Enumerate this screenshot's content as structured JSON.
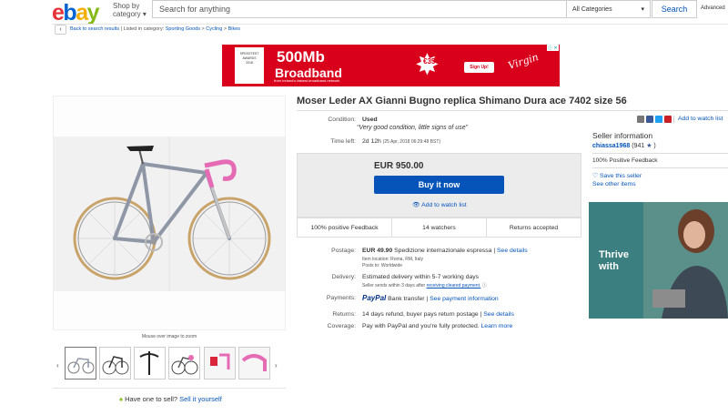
{
  "header": {
    "logo_letters": [
      "e",
      "b",
      "a",
      "y"
    ],
    "logo_colors": [
      "#e53238",
      "#0064d2",
      "#f5af02",
      "#86b817"
    ],
    "shop_by_line1": "Shop by",
    "shop_by_line2": "category",
    "search_placeholder": "Search for anything",
    "category_select": "All Categories",
    "search_button": "Search",
    "advanced": "Advanced"
  },
  "breadcrumb": {
    "back": "Back to search results",
    "listed_in": "| Listed in category:",
    "items": [
      "Sporting Goods",
      "Cycling",
      "Bikes"
    ],
    "sep": ">"
  },
  "banner": {
    "title": "500Mb",
    "subtitle": "Broadband",
    "tagline": "from Ireland's fastest broadband network",
    "badge_line1": "SPEEDTEST",
    "badge_line2": "AWARDS",
    "badge_line3": "2018",
    "price": "€35",
    "signup": "Sign Up!",
    "brand": "Virgin",
    "close": "ⓘ ✕"
  },
  "gallery": {
    "mouse_over": "Mouse over image to zoom",
    "sell_prefix": "Have one to sell?",
    "sell_link": "Sell it yourself"
  },
  "item": {
    "title": "Moser Leder AX Gianni Bugno replica Shimano Dura ace 7402 size 56",
    "condition_label": "Condition:",
    "condition_value": "Used",
    "condition_note": "“Very good condition, little signs of use”",
    "time_label": "Time left:",
    "time_value": "2d 12h",
    "time_detail": "(25 Apr, 2018 06:29:48 BST)",
    "price": "EUR 950.00",
    "buy_now": "Buy it now",
    "add_watch": "Add to watch list",
    "stats": [
      "100% positive Feedback",
      "14 watchers",
      "Returns accepted"
    ],
    "add_watch_top": "Add to watch list"
  },
  "shipping": {
    "postage_label": "Postage:",
    "postage_price": "EUR 49.90",
    "postage_method": "Spedizione internazionale espressa",
    "postage_link": "See details",
    "item_location": "Item location:  Roma, RM, Italy",
    "posts_to": "Posts to:  Worldwide",
    "delivery_label": "Delivery:",
    "delivery_value": "Estimated delivery within 5-7 working days",
    "delivery_note_prefix": "Seller sends within 3 days after",
    "delivery_note_link": "receiving cleared payment.",
    "payments_label": "Payments:",
    "paypal": "PayPal",
    "bank": "Bank transfer",
    "payments_link": "See payment information",
    "returns_label": "Returns:",
    "returns_value": "14 days refund, buyer pays return postage",
    "returns_link": "See details",
    "coverage_label": "Coverage:",
    "coverage_value": "Pay with PayPal and you're fully protected.",
    "coverage_link": "Learn more"
  },
  "seller": {
    "title": "Seller information",
    "name": "chiassa1968",
    "score": "(941",
    "close_paren": ")",
    "feedback": "100% Positive Feedback",
    "save": "Save this seller",
    "other": "See other items"
  },
  "right_ad": {
    "line1": "Thrive",
    "line2": "with"
  }
}
